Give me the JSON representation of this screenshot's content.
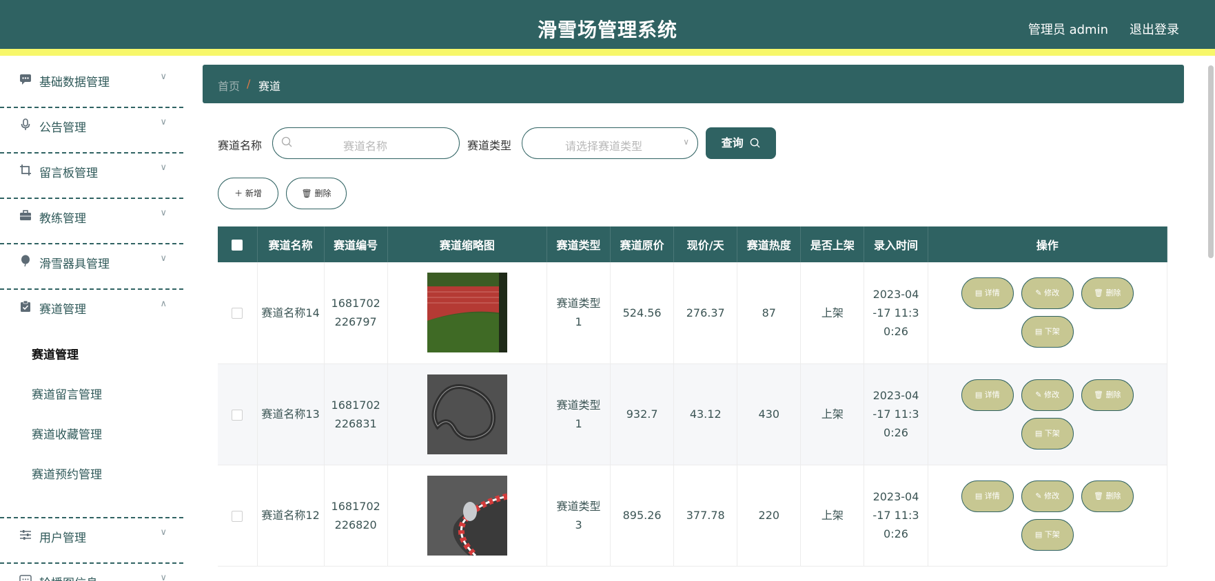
{
  "header": {
    "title": "滑雪场管理系统",
    "user": "管理员 admin",
    "logout": "退出登录"
  },
  "sidebar": {
    "items": [
      {
        "label": "基础数据管理",
        "icon": "chat-bubble-icon"
      },
      {
        "label": "公告管理",
        "icon": "microphone-icon"
      },
      {
        "label": "留言板管理",
        "icon": "crop-icon"
      },
      {
        "label": "教练管理",
        "icon": "briefcase-icon"
      },
      {
        "label": "滑雪器具管理",
        "icon": "balloon-icon"
      },
      {
        "label": "赛道管理",
        "icon": "clipboard-icon",
        "open": true
      },
      {
        "label": "用户管理",
        "icon": "sliders-icon"
      },
      {
        "label": "轮播图信息",
        "icon": "message-icon"
      }
    ],
    "submenu": [
      "赛道管理",
      "赛道留言管理",
      "赛道收藏管理",
      "赛道预约管理"
    ]
  },
  "breadcrumb": {
    "home": "首页",
    "sep": "/",
    "current": "赛道"
  },
  "search": {
    "name_label": "赛道名称",
    "name_placeholder": "赛道名称",
    "type_label": "赛道类型",
    "type_placeholder": "请选择赛道类型",
    "query": "查询"
  },
  "actions": {
    "add": "新增",
    "delete": "删除"
  },
  "table": {
    "headers": [
      "赛道名称",
      "赛道编号",
      "赛道缩略图",
      "赛道类型",
      "赛道原价",
      "现价/天",
      "赛道热度",
      "是否上架",
      "录入时间",
      "操作"
    ],
    "rows": [
      {
        "name": "赛道名称14",
        "code": "1681702226797",
        "type": "赛道类型1",
        "price": "524.56",
        "now": "276.37",
        "hot": "87",
        "status": "上架",
        "time": "2023-04-17 11:30:26"
      },
      {
        "name": "赛道名称13",
        "code": "1681702226831",
        "type": "赛道类型1",
        "price": "932.7",
        "now": "43.12",
        "hot": "430",
        "status": "上架",
        "time": "2023-04-17 11:30:26"
      },
      {
        "name": "赛道名称12",
        "code": "1681702226820",
        "type": "赛道类型3",
        "price": "895.26",
        "now": "377.78",
        "hot": "220",
        "status": "上架",
        "time": "2023-04-17 11:30:26"
      }
    ],
    "ops": {
      "detail": "详情",
      "edit": "修改",
      "delete": "删除",
      "offline": "下架"
    }
  }
}
